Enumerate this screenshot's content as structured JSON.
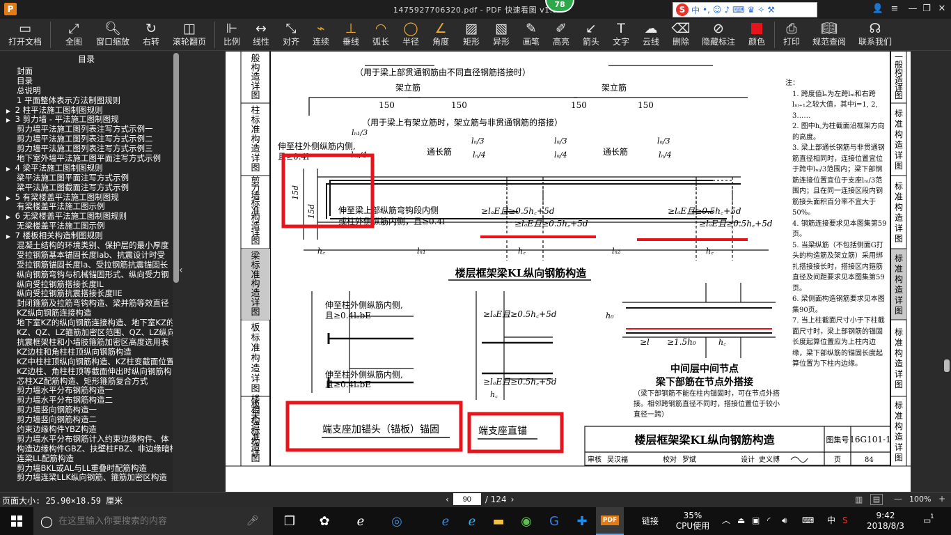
{
  "window": {
    "title": "1475927706320.pdf - PDF 快速看图 v1.9",
    "logo": "P",
    "badge": "78",
    "ime_logo": "S",
    "ime_lang": "中"
  },
  "toolbar": {
    "open_file": "打开文档",
    "fit_all": "全图",
    "window_zoom": "窗口缩放",
    "rotate_right": "右转",
    "scroll_page": "滚轮翻页",
    "scale": "比例",
    "linear": "线性",
    "align": "对齐",
    "continuous": "连续",
    "perpendicular": "垂线",
    "arc_length": "弧长",
    "radius": "半径",
    "angle": "角度",
    "rectangle": "矩形",
    "irregular": "异形",
    "pen": "画笔",
    "highlight": "高亮",
    "arrow": "箭头",
    "text": "文字",
    "cloud_line": "云线",
    "delete": "删除",
    "hide_marks": "隐藏标注",
    "color": "颜色",
    "color_value": "#e8141b",
    "print": "打印",
    "spec_query": "规范查阅",
    "contact_us": "联系我们"
  },
  "sidebar": {
    "header": "目录",
    "items": [
      {
        "label": "封面",
        "indent": 1,
        "arrow": ""
      },
      {
        "label": "目录",
        "indent": 1,
        "arrow": ""
      },
      {
        "label": "总说明",
        "indent": 1,
        "arrow": ""
      },
      {
        "label": "1  平面整体表示方法制图规则",
        "indent": 1,
        "arrow": ""
      },
      {
        "label": "2  柱平法施工图制图规则",
        "indent": 0,
        "arrow": "▶"
      },
      {
        "label": "3  剪力墙 - 平法施工图制图规",
        "indent": 0,
        "arrow": "▶"
      },
      {
        "label": "剪力墙平法施工图列表注写方式示例一",
        "indent": 1,
        "arrow": ""
      },
      {
        "label": "剪力墙平法施工图列表注写方式示例二",
        "indent": 1,
        "arrow": ""
      },
      {
        "label": "剪力墙平法施工图列表注写方式示例三",
        "indent": 1,
        "arrow": ""
      },
      {
        "label": "地下室外墙平法施工图平面注写方式示例",
        "indent": 1,
        "arrow": ""
      },
      {
        "label": "4  梁平法施工图制图规则",
        "indent": 0,
        "arrow": "▶"
      },
      {
        "label": "梁平法施工图平面注写方式示例",
        "indent": 1,
        "arrow": ""
      },
      {
        "label": "梁平法施工图截面注写方式示例",
        "indent": 1,
        "arrow": ""
      },
      {
        "label": "5  有梁楼盖平法施工图制图规",
        "indent": 0,
        "arrow": "▶"
      },
      {
        "label": "有梁楼盖平法施工图示例",
        "indent": 1,
        "arrow": ""
      },
      {
        "label": "6  无梁楼盖平法施工图制图规则",
        "indent": 0,
        "arrow": "▶"
      },
      {
        "label": "无梁楼盖平法施工图示例",
        "indent": 1,
        "arrow": ""
      },
      {
        "label": "7  楼板相关构造制图规则",
        "indent": 0,
        "arrow": "▶"
      },
      {
        "label": "混凝土结构的环境类别、保护层的最小厚度",
        "indent": 1,
        "arrow": ""
      },
      {
        "label": "受拉钢筋基本锚固长度lab、抗震设计时受",
        "indent": 1,
        "arrow": ""
      },
      {
        "label": "受拉钢筋锚固长度la、受拉钢筋抗震锚固长",
        "indent": 1,
        "arrow": ""
      },
      {
        "label": "纵向钢筋弯钩与机械锚固形式、纵向受力钢",
        "indent": 1,
        "arrow": ""
      },
      {
        "label": "纵向受拉钢筋搭接长度lL",
        "indent": 1,
        "arrow": ""
      },
      {
        "label": "纵向受拉钢筋抗震搭接长度llE",
        "indent": 1,
        "arrow": ""
      },
      {
        "label": "封闭箍筋及拉筋弯钩构造、梁并筋等效直径",
        "indent": 1,
        "arrow": ""
      },
      {
        "label": "KZ纵向钢筋连接构造",
        "indent": 1,
        "arrow": ""
      },
      {
        "label": "地下室KZ的纵向钢筋连接构造、地下室KZ的",
        "indent": 1,
        "arrow": ""
      },
      {
        "label": "KZ、QZ、LZ箍筋加密区范围、QZ、LZ纵向钢",
        "indent": 1,
        "arrow": ""
      },
      {
        "label": "抗震框架柱和小墙肢箍筋加密区高度选用表",
        "indent": 1,
        "arrow": ""
      },
      {
        "label": "KZ边柱和角柱柱顶纵向钢筋构造",
        "indent": 1,
        "arrow": ""
      },
      {
        "label": "KZ中柱柱顶纵向钢筋构造、KZ柱变截面位置",
        "indent": 1,
        "arrow": ""
      },
      {
        "label": "KZ边柱、角柱柱顶等截面伸出时纵向钢筋构",
        "indent": 1,
        "arrow": ""
      },
      {
        "label": "芯柱XZ配筋构造、矩形箍筋复合方式",
        "indent": 1,
        "arrow": ""
      },
      {
        "label": "剪力墙水平分布钢筋构造一",
        "indent": 1,
        "arrow": ""
      },
      {
        "label": "剪力墙水平分布钢筋构造二",
        "indent": 1,
        "arrow": ""
      },
      {
        "label": "剪力墙竖向钢筋构造一",
        "indent": 1,
        "arrow": ""
      },
      {
        "label": "剪力墙竖向钢筋构造二",
        "indent": 1,
        "arrow": ""
      },
      {
        "label": "约束边缘构件YBZ构造",
        "indent": 1,
        "arrow": ""
      },
      {
        "label": "剪力墙水平分布钢筋计入约束边缘构件、体",
        "indent": 1,
        "arrow": ""
      },
      {
        "label": "构造边缘构件GBZ、扶壁柱FBZ、非边缘暗柱",
        "indent": 1,
        "arrow": ""
      },
      {
        "label": "连梁LL配筋构造",
        "indent": 1,
        "arrow": ""
      },
      {
        "label": "剪力墙BKL或AL与LL重叠时配筋构造",
        "indent": 1,
        "arrow": ""
      },
      {
        "label": "剪力墙连梁LLK纵向钢筋、箍筋加密区构造",
        "indent": 1,
        "arrow": ""
      }
    ]
  },
  "document": {
    "left_labels": [
      "般构造详图",
      "柱标准构造详图",
      "剪力墙标准构造详图",
      "梁标准构造详图",
      "板标准构造详图",
      "楼板相关构造标准构造详图"
    ],
    "right_labels": [
      "一般构造详图",
      "标准构造详图",
      "标准构造详图",
      "标准构造详图",
      "标准构造详图",
      "标准构造详图"
    ],
    "caption_1": "（用于梁上部贯通钢筋由不同直径钢筋搭接时）",
    "jialijin": "架立筋",
    "dim_150": "150",
    "caption_2": "（用于梁上有架立筋时，架立筋与非贯通钢筋的搭接）",
    "ln1_3": "lₙ₁/3",
    "ln_3": "lₙ/3",
    "ln1_4": "lₙ₁/4",
    "ln_4": "lₙ/4",
    "tongchangjin": "通长筋",
    "note_outer_1": "伸至柱外侧纵筋内侧,",
    "note_outer_2": "且≥0.4l",
    "note_hook_1": "伸至梁上部纵筋弯钩段内侧",
    "note_hook_2": "或柱外侧纵筋内侧，且≥0.4l",
    "dim_15d": "15d",
    "cond_1": "≥lₐE且≥0.5h꜀+5d",
    "hc": "h꜀",
    "ln1": "lₙ₁",
    "ln2": "lₙ₂",
    "main_caption": "楼层框架梁KL纵向钢筋构造",
    "sub_cond_1": "伸至柱外侧纵筋内侧,",
    "sub_cond_2": "且≥0.4lₐbE",
    "sub_cond_3": "≥lₐE且≥0.5h꜀+5d",
    "node_label_1": "中间层中间节点",
    "node_label_2": "梁下部筋在节点外搭接",
    "node_cond_1": "≥l",
    "node_cond_2": "≥1.5h₀",
    "h0": "h₀",
    "node_note": "（梁下部钢筋不能在柱内锚固时，可在节点外搭接。相邻跨钢筋直径不同时，搭接位置位于较小直径一跨）",
    "label_anchor_head": "端支座加锚头（锚板）锚固",
    "label_straight": "端支座直锚",
    "notes_title": "注：",
    "notes": [
      "1. 跨度值lₙ为左跨lₙᵢ和右跨lₙᵢ₊₁之较大值，其中i=1, 2, 3……",
      "2. 图中h꜀为柱截面沿框架方向的高度。",
      "3. 梁上部通长钢筋与非贯通钢筋直径相同时，连接位置宜位于跨中lₙᵢ/3范围内；梁下部钢筋连接位置宜位于支座lₙᵢ/3范围内；且在同一连接区段内钢筋接头面积百分率不宜大于50%。",
      "4. 钢筋连接要求见本图集第59页。",
      "5. 当梁纵筋（不包括侧面G打头的构造筋及架立筋）采用绑扎搭接接长时，搭接区内箍筋直径及间距要求见本图集第59页。",
      "6. 梁侧面构造钢筋要求见本图集90页。",
      "7. 当上柱截面尺寸小于下柱截面尺寸时，梁上部钢筋的锚固长度起算位置应为上柱内边缘，梁下部纵筋的锚固长度起算位置为下柱内边缘。"
    ],
    "title_block": {
      "title": "楼层框架梁KL纵向钢筋构造",
      "atlas_label": "图集号",
      "atlas_no": "16G101-1",
      "review_label": "审核",
      "reviewer": "吴汉福",
      "check_label": "校对",
      "checker": "罗斌",
      "design_label": "设计",
      "designer": "史义博",
      "page_label": "页",
      "page_no": "84"
    }
  },
  "status": {
    "page_size": "页面大小: 25.90×18.59 厘米",
    "current_page": "90",
    "total_pages": "/ 124",
    "zoom": "100%"
  },
  "taskbar": {
    "search_placeholder": "在这里输入你要搜索的内容",
    "link_label": "链接",
    "cpu_percent": "35%",
    "cpu_label": "CPU使用",
    "ime_lang": "中",
    "time": "9:42",
    "date": "2018/8/3",
    "notify_count": "1"
  }
}
